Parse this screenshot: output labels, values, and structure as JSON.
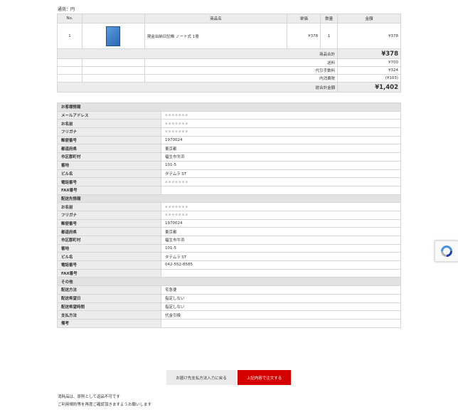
{
  "currency_label": "通貨：円",
  "order": {
    "headers": {
      "no": "No.",
      "name": "商品名",
      "price": "単価",
      "qty": "数量",
      "amount": "金額"
    },
    "item": {
      "no": "1",
      "image": "product-thumbnail",
      "name": "現金出納日記帳 ノート式 1冊",
      "price": "¥378",
      "qty": "1",
      "amount": "¥378"
    },
    "subtotal_label": "商品合計",
    "subtotal_value": "¥378",
    "shipping_label": "送料",
    "shipping_value": "¥700",
    "cod_fee_label": "代引手数料",
    "cod_fee_value": "¥324",
    "tax_label": "内消費税",
    "tax_value": "(¥103)",
    "total_label": "総合計金額",
    "total_value": "¥1,402"
  },
  "customer": {
    "section_title": "お客様情報",
    "rows": [
      {
        "label": "メールアドレス",
        "value": "",
        "masked": true
      },
      {
        "label": "お名前",
        "value": "",
        "masked": true
      },
      {
        "label": "フリガナ",
        "value": "",
        "masked": true
      },
      {
        "label": "郵便番号",
        "value": "1970024"
      },
      {
        "label": "都道府県",
        "value": "東京都"
      },
      {
        "label": "市区郡町村",
        "value": "福生市牛浜"
      },
      {
        "label": "番地",
        "value": "101-5"
      },
      {
        "label": "ビル名",
        "value": "タテムラ ST"
      },
      {
        "label": "電話番号",
        "value": "",
        "masked": true
      },
      {
        "label": "FAX番号",
        "value": ""
      }
    ]
  },
  "shipping_address": {
    "section_title": "配送先情報",
    "rows": [
      {
        "label": "お名前",
        "value": "",
        "masked": true
      },
      {
        "label": "フリガナ",
        "value": "",
        "masked": true
      },
      {
        "label": "郵便番号",
        "value": "1970024"
      },
      {
        "label": "都道府県",
        "value": "東京都"
      },
      {
        "label": "市区郡町村",
        "value": "福生市牛浜"
      },
      {
        "label": "番地",
        "value": "101-5"
      },
      {
        "label": "ビル名",
        "value": "タテムラ ST"
      },
      {
        "label": "電話番号",
        "value": "042-552-8585"
      },
      {
        "label": "FAX番号",
        "value": ""
      }
    ]
  },
  "other": {
    "section_title": "その他",
    "rows": [
      {
        "label": "配送方法",
        "value": "宅急便"
      },
      {
        "label": "配送希望日",
        "value": "指定しない"
      },
      {
        "label": "配送希望時間",
        "value": "指定しない"
      },
      {
        "label": "支払方法",
        "value": "代金引換"
      },
      {
        "label": "備考",
        "value": ""
      }
    ]
  },
  "buttons": {
    "back": "お届け先支払方法入力に戻る",
    "submit": "上記内容で注文する"
  },
  "notes": [
    "消耗品は、原則として返品不可です",
    "ご利用規約等を再度ご確認頂きますようお願いします"
  ],
  "colors": {
    "accent": "#d40000",
    "header_bg": "#ececec"
  },
  "captcha_icon": "recaptcha-icon"
}
